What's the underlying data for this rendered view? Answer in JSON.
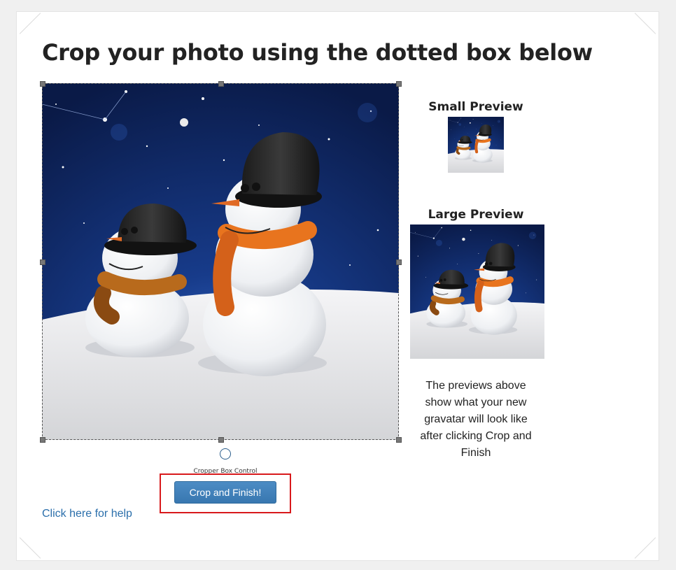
{
  "page": {
    "title": "Crop your photo using the dotted box below"
  },
  "cropper": {
    "control_label": "Cropper Box Control",
    "button_label": "Crop and Finish!"
  },
  "previews": {
    "small_heading": "Small Preview",
    "large_heading": "Large Preview",
    "note": "The previews above show what your new gravatar will look like after clicking Crop and Finish"
  },
  "help": {
    "link_text": "Click here for help"
  },
  "colors": {
    "button": "#3f80bb",
    "link": "#2b6fab",
    "highlight": "#d8191c",
    "sky": "#0d2259",
    "scarf_small": "#b86a1c",
    "scarf_large": "#e8741e"
  },
  "image": {
    "subject": "two snowmen in top hats and scarves on a snowy hill under a starry night sky"
  }
}
